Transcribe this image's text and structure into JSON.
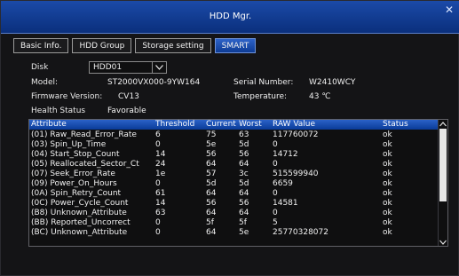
{
  "window": {
    "title": "HDD Mgr.",
    "close_icon": "close-icon"
  },
  "tabs": [
    {
      "label": "Basic Info.",
      "active": false
    },
    {
      "label": "HDD Group",
      "active": false
    },
    {
      "label": "Storage setting",
      "active": false
    },
    {
      "label": "SMART",
      "active": true
    }
  ],
  "disk": {
    "label": "Disk",
    "selected": "HDD01"
  },
  "info": {
    "model_label": "Model:",
    "model_value": "ST2000VX000-9YW164",
    "serial_label": "Serial Number:",
    "serial_value": "W2410WCY",
    "firmware_label": "Firmware Version:",
    "firmware_value": "CV13",
    "temperature_label": "Temperature:",
    "temperature_value": "43 ℃",
    "health_label": "Health Status",
    "health_value": "Favorable"
  },
  "table": {
    "columns": [
      "Attribute",
      "Threshold",
      "Current",
      "Worst",
      "RAW Value",
      "Status"
    ],
    "rows": [
      [
        "(01) Raw_Read_Error_Rate",
        "6",
        "75",
        "63",
        "117760072",
        "ok"
      ],
      [
        "(03) Spin_Up_Time",
        "0",
        "5e",
        "5d",
        "0",
        "ok"
      ],
      [
        "(04) Start_Stop_Count",
        "14",
        "56",
        "56",
        "14712",
        "ok"
      ],
      [
        "(05) Reallocated_Sector_Ct",
        "24",
        "64",
        "64",
        "0",
        "ok"
      ],
      [
        "(07) Seek_Error_Rate",
        "1e",
        "57",
        "3c",
        "515599940",
        "ok"
      ],
      [
        "(09) Power_On_Hours",
        "0",
        "5d",
        "5d",
        "6659",
        "ok"
      ],
      [
        "(0A) Spin_Retry_Count",
        "61",
        "64",
        "64",
        "0",
        "ok"
      ],
      [
        "(0C) Power_Cycle_Count",
        "14",
        "56",
        "56",
        "14581",
        "ok"
      ],
      [
        "(B8) Unknown_Attribute",
        "63",
        "64",
        "64",
        "0",
        "ok"
      ],
      [
        "(BB) Reported_Uncorrect",
        "0",
        "5f",
        "5f",
        "5",
        "ok"
      ],
      [
        "(BC) Unknown_Attribute",
        "0",
        "64",
        "5e",
        "25770328072",
        "ok"
      ]
    ]
  },
  "colors": {
    "titlebar": "#1b4aa8",
    "header": "#2a62c8",
    "background": "#141416"
  }
}
